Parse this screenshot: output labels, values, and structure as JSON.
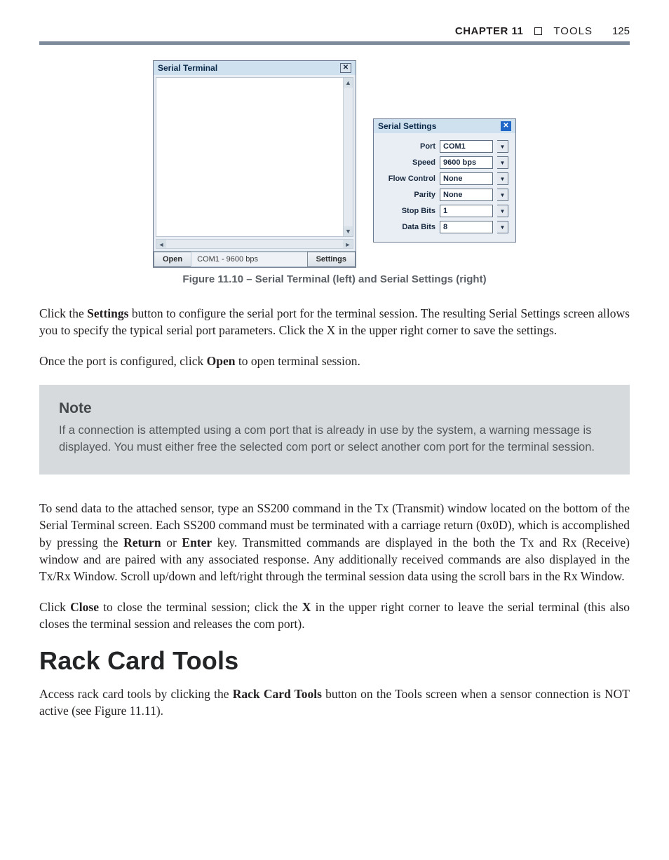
{
  "header": {
    "chapter": "CHAPTER 11",
    "section": "TOOLS",
    "page": "125"
  },
  "figure": {
    "terminal": {
      "title": "Serial Terminal",
      "open_btn": "Open",
      "status": "COM1 - 9600 bps",
      "settings_btn": "Settings"
    },
    "settings": {
      "title": "Serial Settings",
      "rows": {
        "port": {
          "label": "Port",
          "value": "COM1"
        },
        "speed": {
          "label": "Speed",
          "value": "9600 bps"
        },
        "flow": {
          "label": "Flow Control",
          "value": "None"
        },
        "parity": {
          "label": "Parity",
          "value": "None"
        },
        "stop": {
          "label": "Stop Bits",
          "value": "1"
        },
        "data": {
          "label": "Data Bits",
          "value": "8"
        }
      }
    },
    "caption": "Figure 11.10 – Serial Terminal (left) and Serial Settings (right)"
  },
  "para1_a": "Click the ",
  "para1_b": "Settings",
  "para1_c": " button to configure the serial port for the terminal session. The resulting Serial Settings screen allows you to specify the typical serial port parameters. Click the X in the upper right corner to save the settings.",
  "para2_a": "Once the port is configured, click ",
  "para2_b": "Open",
  "para2_c": " to open terminal session.",
  "note": {
    "heading": "Note",
    "body": "If a connection is attempted using a com port that is already in use by the system, a warning message is displayed. You must either free the selected com port or select another com port for the terminal session."
  },
  "para3_a": "To send data to the attached sensor, type an SS200 command in the Tx (Transmit) window located on the bottom of the Serial Terminal screen. Each SS200 command must be terminated with a carriage return (0x0D), which is accomplished by pressing the ",
  "para3_b": "Return",
  "para3_c": " or ",
  "para3_d": "Enter",
  "para3_e": " key. Transmitted commands are displayed in the both the Tx and Rx (Receive) window and are paired with any associated response. Any additionally received commands are also displayed in the Tx/Rx Window. Scroll up/down and left/right through the terminal session data using the scroll bars in the Rx Window.",
  "para4_a": "Click ",
  "para4_b": "Close",
  "para4_c": " to close the terminal session; click the ",
  "para4_d": "X",
  "para4_e": " in the upper right corner to leave the serial terminal (this also closes the terminal session and releases the com port).",
  "section_heading": "Rack Card Tools",
  "para5_a": "Access rack card tools by clicking the ",
  "para5_b": "Rack Card Tools",
  "para5_c": " button on the Tools screen when a sensor connection is NOT active (see Figure 11.11)."
}
